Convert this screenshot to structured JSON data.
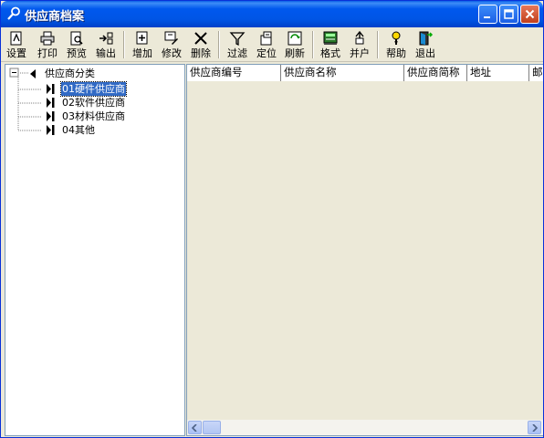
{
  "window": {
    "title": "供应商档案"
  },
  "title_buttons": {
    "minimize": "minimize-icon",
    "maximize": "maximize-icon",
    "close": "close-icon"
  },
  "toolbar": {
    "items": [
      {
        "label": "设置",
        "icon": "settings-icon"
      },
      {
        "label": "打印",
        "icon": "print-icon"
      },
      {
        "label": "预览",
        "icon": "preview-icon"
      },
      {
        "label": "输出",
        "icon": "export-icon"
      },
      {
        "label": "增加",
        "icon": "add-icon"
      },
      {
        "label": "修改",
        "icon": "edit-icon"
      },
      {
        "label": "删除",
        "icon": "delete-icon"
      },
      {
        "label": "过滤",
        "icon": "filter-icon"
      },
      {
        "label": "定位",
        "icon": "locate-icon"
      },
      {
        "label": "刷新",
        "icon": "refresh-icon"
      },
      {
        "label": "格式",
        "icon": "format-icon"
      },
      {
        "label": "并户",
        "icon": "merge-icon"
      },
      {
        "label": "帮助",
        "icon": "help-icon"
      },
      {
        "label": "退出",
        "icon": "exit-icon"
      }
    ]
  },
  "tree": {
    "root": "供应商分类",
    "nodes": [
      "01硬件供应商",
      "02软件供应商",
      "03材料供应商",
      "04其他"
    ],
    "selected_index": 0,
    "collapse_symbol": "⊟"
  },
  "grid": {
    "columns": [
      "供应商编号",
      "供应商名称",
      "供应商简称",
      "地址",
      "邮"
    ]
  },
  "colors": {
    "titlebar": "#0058ee",
    "face": "#ece9d8",
    "selection": "#316ac5"
  }
}
